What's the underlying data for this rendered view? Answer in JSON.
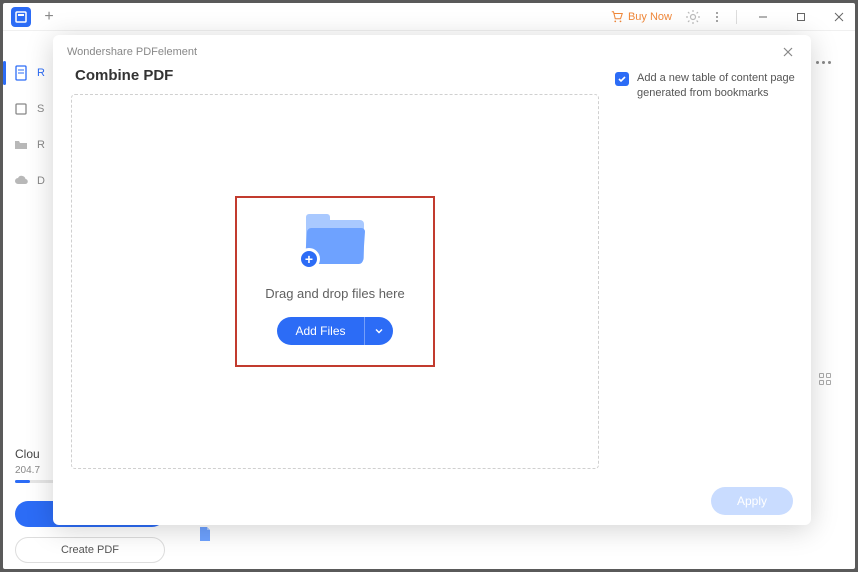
{
  "titlebar": {
    "buy_now": "Buy Now"
  },
  "sidebar": {
    "items": [
      {
        "label": "R"
      },
      {
        "label": "S"
      },
      {
        "label": "R"
      },
      {
        "label": "D"
      }
    ]
  },
  "cloud": {
    "label": "Clou",
    "size": "204.7"
  },
  "create_pdf_label": "Create PDF",
  "modal": {
    "app_title": "Wondershare PDFelement",
    "title": "Combine PDF",
    "drop_text": "Drag and drop files here",
    "add_files_label": "Add Files",
    "toc_checkbox_label": "Add a new table of content page generated from bookmarks",
    "apply_label": "Apply"
  }
}
